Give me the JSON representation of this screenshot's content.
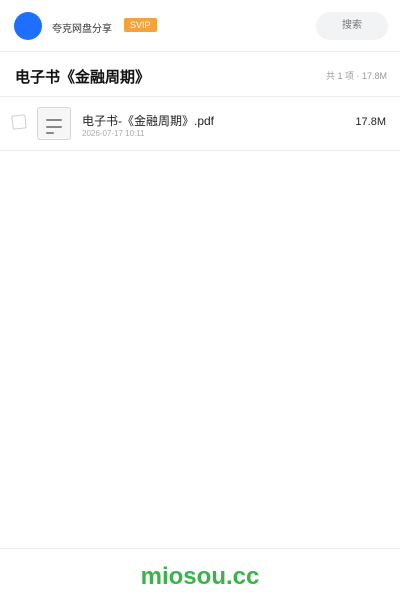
{
  "header": {
    "brand": "夸克网盘分享",
    "badge": "SVIP",
    "search_placeholder": "搜索"
  },
  "folder": {
    "title": "电子书《金融周期》",
    "summary": "共 1 项 · 17.8M"
  },
  "files": [
    {
      "name": "电子书-《金融周期》.pdf",
      "date": "2026-07-17 10:11",
      "size": "17.8M",
      "icon": "document-icon"
    }
  ],
  "footer": {
    "text": "miosou.cc"
  },
  "colors": {
    "avatar": "#1e6fff",
    "badge": "#f5a23a",
    "footer_text": "#3bb34a"
  }
}
